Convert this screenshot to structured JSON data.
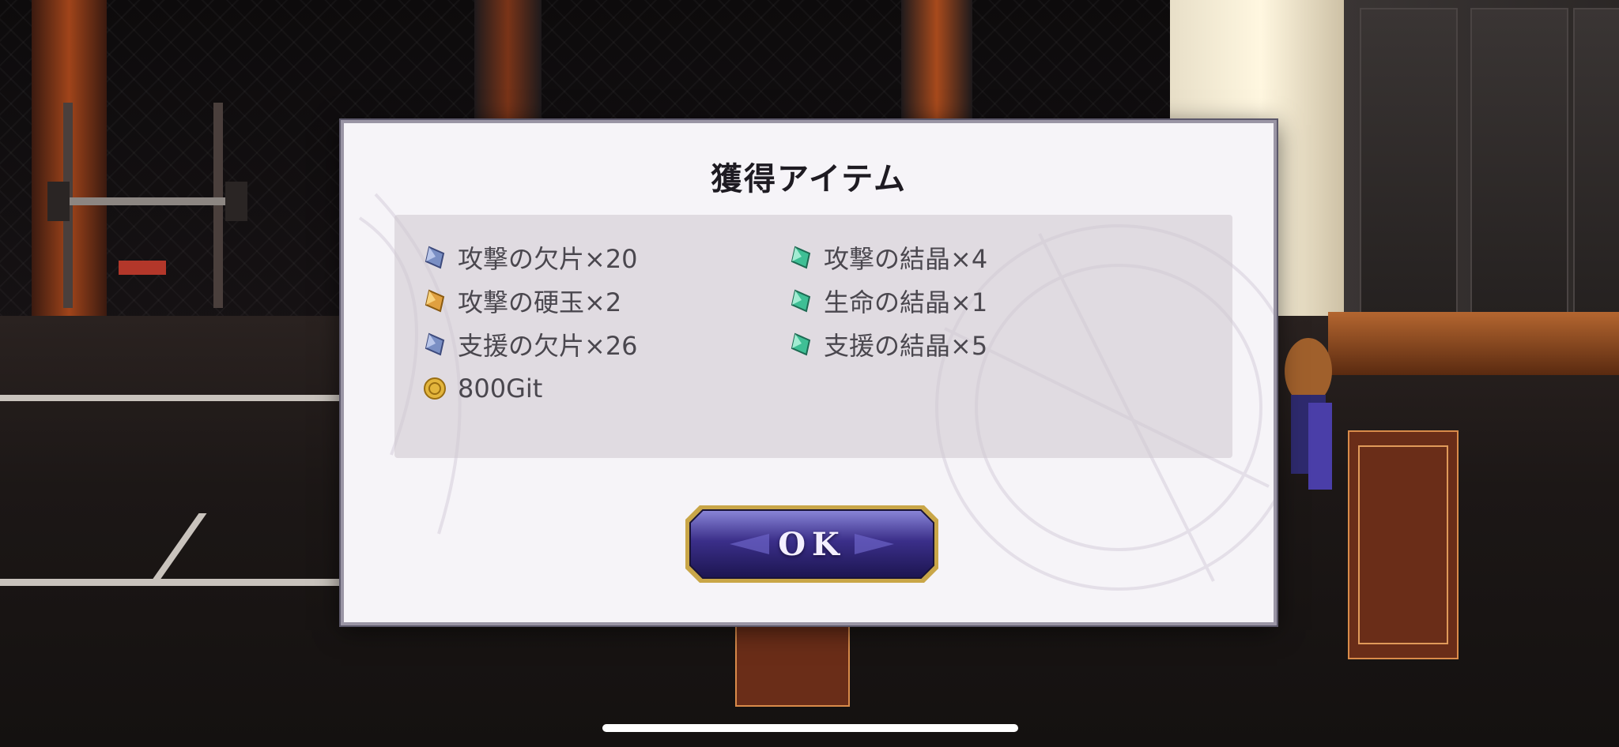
{
  "dialog": {
    "title": "獲得アイテム",
    "items_left": [
      {
        "label": "攻撃の欠片×20",
        "icon": "blue-crystal-icon",
        "color": "#7a8fc4"
      },
      {
        "label": "攻撃の硬玉×2",
        "icon": "orange-crystal-icon",
        "color": "#e0a040"
      },
      {
        "label": "支援の欠片×26",
        "icon": "blue-crystal-icon",
        "color": "#7a8fc4"
      },
      {
        "label": "800Git",
        "icon": "gold-coin-icon",
        "color": "#e3b53c"
      }
    ],
    "items_right": [
      {
        "label": "攻撃の結晶×4",
        "icon": "green-crystal-icon",
        "color": "#3fbf95"
      },
      {
        "label": "生命の結晶×1",
        "icon": "green-crystal-icon",
        "color": "#3fbf95"
      },
      {
        "label": "支援の結晶×5",
        "icon": "green-crystal-icon",
        "color": "#3fbf95"
      }
    ],
    "ok_label": "OK"
  },
  "colors": {
    "button_fill": "#3b2f8a",
    "button_border": "#c9a648",
    "panel": "#ddd6dd"
  }
}
